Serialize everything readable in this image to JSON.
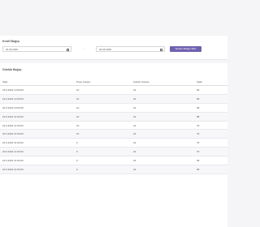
{
  "filter": {
    "title": "Kesilf Bağışı",
    "start_date": "01.06.2026",
    "end_date": "02.06.2026",
    "separator": "-",
    "button_label": "Seçilen Bağışı Ekle"
  },
  "table": {
    "title": "Günlük Bağışı",
    "columns": [
      "Saat",
      "Proje Susete",
      "Göksin Susete",
      "Saatı"
    ],
    "rows": [
      [
        "22.6.2022 13:00:00",
        "10",
        "22",
        "99"
      ],
      [
        "22.6.2022 12:00:00",
        "10",
        "22",
        "99"
      ],
      [
        "22.6.2022 10:00:00",
        "10",
        "22",
        "99"
      ],
      [
        "22.6.2022 11:00:00",
        "10",
        "22",
        "98"
      ],
      [
        "22.6.2022 11:00:00",
        "10",
        "22",
        "79"
      ],
      [
        "22.6.2022 11:00:00",
        "10",
        "22",
        "79"
      ],
      [
        "22.6.2022 11:00:00",
        "0",
        "22",
        "79"
      ],
      [
        "22.6.2022 11:00:00",
        "0",
        "22",
        "79"
      ],
      [
        "22.6.2022 11:00:00",
        "0",
        "22",
        "99"
      ],
      [
        "22.6.2022 11:00:00",
        "0",
        "22",
        "99"
      ]
    ]
  }
}
